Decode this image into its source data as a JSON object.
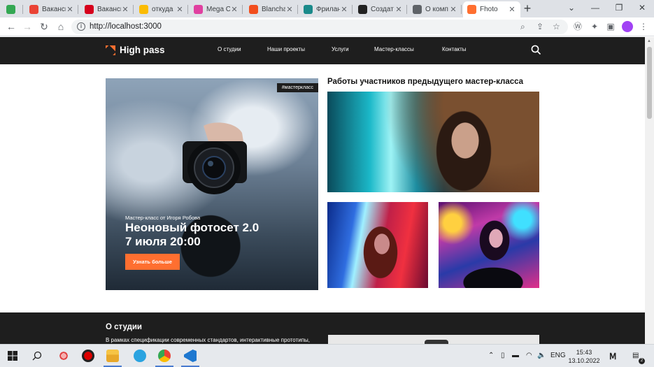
{
  "browser": {
    "tabs": [
      {
        "title": "",
        "favicon_color": "#34a853",
        "active": false
      },
      {
        "title": "Ваканси",
        "favicon_color": "#ea4335",
        "active": false
      },
      {
        "title": "Ваканси",
        "favicon_color": "#d6001c",
        "active": false
      },
      {
        "title": "откуда",
        "favicon_color": "#fbbc04",
        "active": false
      },
      {
        "title": "Mega C",
        "favicon_color": "#e040a0",
        "active": false
      },
      {
        "title": "Blancha",
        "favicon_color": "#f24e1e",
        "active": false
      },
      {
        "title": "Фрилан",
        "favicon_color": "#1a8a8a",
        "active": false
      },
      {
        "title": "Создат",
        "favicon_color": "#222222",
        "active": false
      },
      {
        "title": "О комп",
        "favicon_color": "#5f6368",
        "active": false
      },
      {
        "title": "Fhoto",
        "favicon_color": "#ff6f30",
        "active": true
      }
    ],
    "new_tab_label": "+",
    "url": "http://localhost:3000",
    "window_controls": [
      "⌄",
      "—",
      "❐",
      "✕"
    ]
  },
  "site": {
    "logo_text": "High pass",
    "nav": [
      "О студии",
      "Наши проекты",
      "Услуги",
      "Мастер-классы",
      "Контакты"
    ],
    "accent_color": "#ff6f30",
    "header_color": "#1e1e1e"
  },
  "hero": {
    "tag": "#мастеркласс",
    "subtitle": "Мастер-класс от Игоря Робова",
    "title_line1": "Неоновый фотосет 2.0",
    "title_line2": "7 июля 20:00",
    "button": "Узнать больше"
  },
  "gallery": {
    "title": "Работы участников предыдущего мастер-класса"
  },
  "about": {
    "title": "О студии",
    "text": "В рамках спецификации современных стандартов, интерактивные прототипы,"
  },
  "taskbar": {
    "lang": "ENG",
    "time": "15:43",
    "date": "13.10.2022",
    "notification_count": "2"
  }
}
